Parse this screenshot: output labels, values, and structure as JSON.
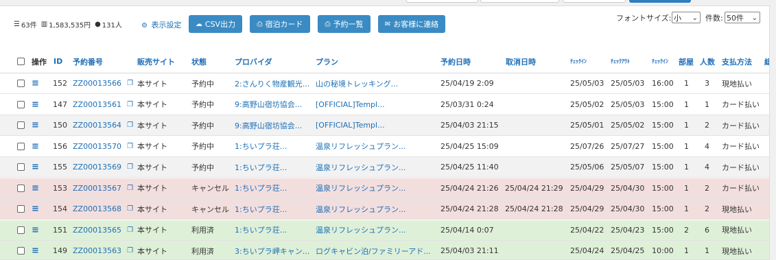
{
  "toolbar": {
    "count": "63件",
    "total": "1,583,535円",
    "people": "131人",
    "display_setting": "表示設定",
    "buttons": {
      "csv": "CSV出力",
      "lodging_card": "宿泊カード",
      "reservation_list": "予約一覧",
      "contact_customer": "お客様に連絡"
    },
    "font_size_label": "フォントサイズ:",
    "font_size_value": "小",
    "count_label": "件数:",
    "count_value": "50件"
  },
  "table": {
    "headers": {
      "action": "操作",
      "id": "ID",
      "reservation_no": "予約番号",
      "sales_site": "販売サイト",
      "status": "状態",
      "provider": "プロバイダ",
      "plan": "プラン",
      "reserved_at": "予約日時",
      "cancelled_at": "取消日時",
      "checkin": "ﾁｪｯｸｲﾝ",
      "checkout": "ﾁｪｯｸｱｳﾄ",
      "checkin_time": "ﾁｪｯｸｲﾝ",
      "rooms": "部屋",
      "people": "人数",
      "payment": "支払方法",
      "extra": "総"
    },
    "rows": [
      {
        "id": "152",
        "no": "ZZ00013566",
        "site": "本サイト",
        "status": "予約中",
        "provider": "2:さんりく物産観光...",
        "plan": "山の秘境トレッキング...",
        "reserved": "25/04/19 2:09",
        "cancelled": "",
        "checkin": "25/05/03",
        "checkout": "25/05/03",
        "time": "16:00",
        "rooms": "1",
        "people": "3",
        "payment": "現地払い",
        "color": "white"
      },
      {
        "id": "147",
        "no": "ZZ00013561",
        "site": "本サイト",
        "status": "予約中",
        "provider": "9:高野山宿坊協会...",
        "plan": "[OFFICIAL]Templ...",
        "reserved": "25/03/31 0:24",
        "cancelled": "",
        "checkin": "25/05/02",
        "checkout": "25/05/03",
        "time": "15:00",
        "rooms": "1",
        "people": "1",
        "payment": "カード払い",
        "color": "white"
      },
      {
        "id": "150",
        "no": "ZZ00013564",
        "site": "本サイト",
        "status": "予約中",
        "provider": "9:高野山宿坊協会...",
        "plan": "[OFFICIAL]Templ...",
        "reserved": "25/04/03 21:15",
        "cancelled": "",
        "checkin": "25/05/01",
        "checkout": "25/05/02",
        "time": "15:00",
        "rooms": "1",
        "people": "2",
        "payment": "カード払い",
        "color": "grey"
      },
      {
        "id": "156",
        "no": "ZZ00013570",
        "site": "本サイト",
        "status": "予約中",
        "provider": "1:ちいプラ荘...",
        "plan": "温泉リフレッシュプラン...",
        "reserved": "25/04/25 15:09",
        "cancelled": "",
        "checkin": "25/07/26",
        "checkout": "25/07/27",
        "time": "15:00",
        "rooms": "1",
        "people": "4",
        "payment": "カード払い",
        "color": "white"
      },
      {
        "id": "155",
        "no": "ZZ00013569",
        "site": "本サイト",
        "status": "予約中",
        "provider": "1:ちいプラ荘...",
        "plan": "温泉リフレッシュプラン...",
        "reserved": "25/04/25 11:40",
        "cancelled": "",
        "checkin": "25/05/06",
        "checkout": "25/05/07",
        "time": "15:00",
        "rooms": "1",
        "people": "4",
        "payment": "カード払い",
        "color": "grey"
      },
      {
        "id": "153",
        "no": "ZZ00013567",
        "site": "本サイト",
        "status": "キャンセル",
        "provider": "1:ちいプラ荘...",
        "plan": "温泉リフレッシュプラン...",
        "reserved": "25/04/24 21:26",
        "cancelled": "25/04/24 21:29",
        "checkin": "25/04/29",
        "checkout": "25/04/30",
        "time": "15:00",
        "rooms": "1",
        "people": "2",
        "payment": "カード払い",
        "color": "pink"
      },
      {
        "id": "154",
        "no": "ZZ00013568",
        "site": "本サイト",
        "status": "キャンセル",
        "provider": "1:ちいプラ荘...",
        "plan": "温泉リフレッシュプラン...",
        "reserved": "25/04/24 21:28",
        "cancelled": "25/04/24 21:28",
        "checkin": "25/04/29",
        "checkout": "25/04/30",
        "time": "15:00",
        "rooms": "1",
        "people": "2",
        "payment": "現地払い",
        "color": "pink"
      },
      {
        "id": "151",
        "no": "ZZ00013565",
        "site": "本サイト",
        "status": "利用済",
        "provider": "1:ちいプラ荘...",
        "plan": "温泉リフレッシュプラン...",
        "reserved": "25/04/14 0:07",
        "cancelled": "",
        "checkin": "25/04/22",
        "checkout": "25/04/23",
        "time": "15:00",
        "rooms": "2",
        "people": "6",
        "payment": "現地払い",
        "color": "green"
      },
      {
        "id": "149",
        "no": "ZZ00013563",
        "site": "本サイト",
        "status": "利用済",
        "provider": "3:ちいプラ岬キャン...",
        "plan": "ログキャビン泊/ファミリーアド...",
        "reserved": "25/04/03 21:11",
        "cancelled": "",
        "checkin": "25/04/24",
        "checkout": "25/04/25",
        "time": "10:00",
        "rooms": "1",
        "people": "1",
        "payment": "現地払い",
        "color": "green"
      }
    ]
  },
  "icons": {
    "list": "list-icon",
    "chart": "bar-chart-icon",
    "users": "users-icon",
    "gear": "gears-icon",
    "cloud": "cloud-download-icon",
    "print": "print-icon",
    "mail": "envelope-icon",
    "menu": "menu-icon",
    "copy": "copy-icon"
  },
  "colors": {
    "button": "#3a8bc4",
    "link": "#1b6fb8",
    "cancel_row": "#f3dede",
    "used_row": "#dff0d8",
    "alt_row": "#f2f2f2"
  }
}
